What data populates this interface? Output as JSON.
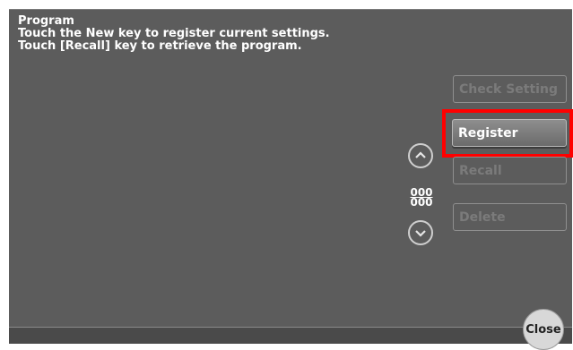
{
  "message": {
    "title": "Program",
    "line1": "Touch the New key to register current settings.",
    "line2": "Touch [Recall] key to retrieve the program."
  },
  "buttons": {
    "check_setting": "Check Setting",
    "register": "Register",
    "recall": "Recall",
    "delete": "Delete",
    "close": "Close"
  },
  "counter": {
    "current": "000",
    "total": "000"
  },
  "icons": {
    "scroll_up": "chevron-up-icon",
    "scroll_down": "chevron-down-icon"
  },
  "colors": {
    "panel": "#5c5c5c",
    "highlight": "#ff0000"
  }
}
